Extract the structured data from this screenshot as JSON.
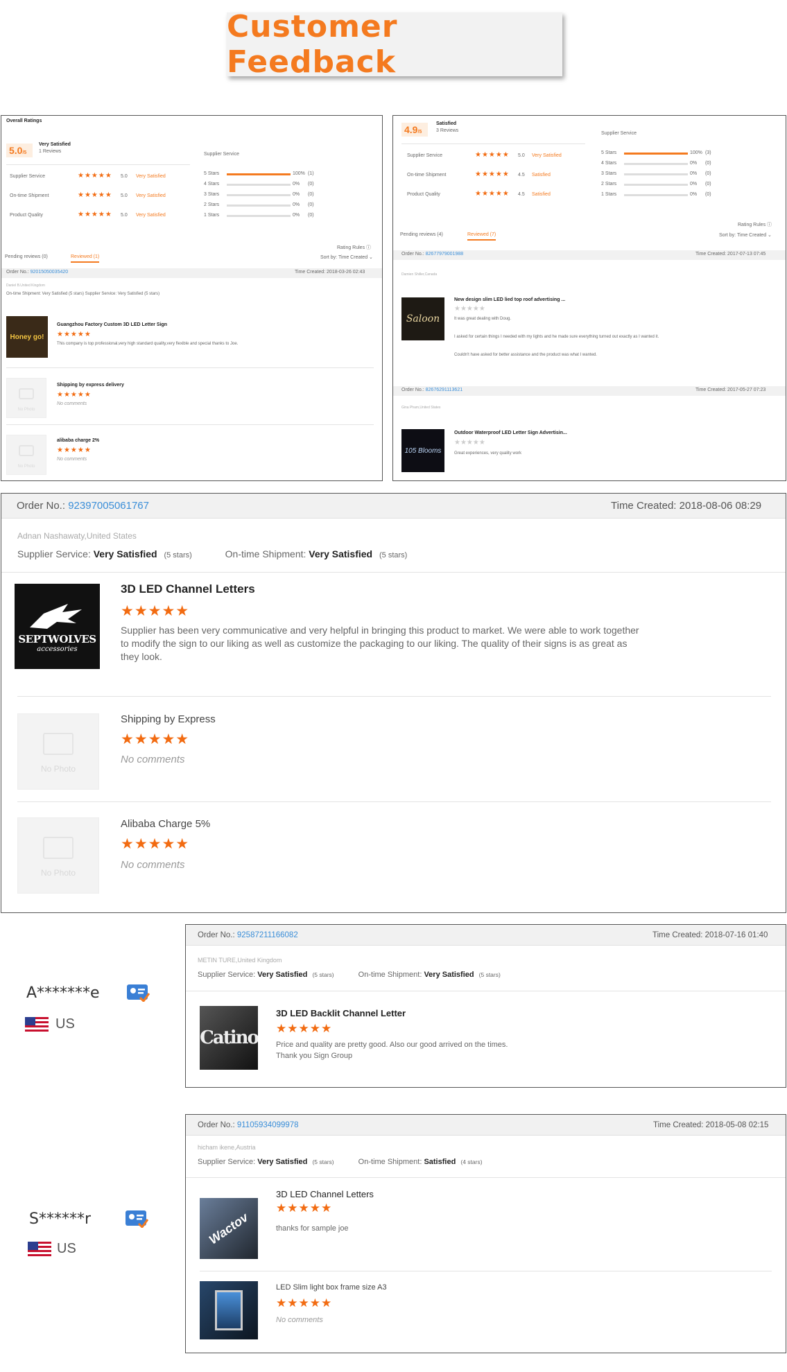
{
  "page": {
    "title": "Customer Feedback"
  },
  "shot1": {
    "overall": "Overall Ratings",
    "score": "5.0",
    "score_suffix": "/5",
    "sat": "Very Satisfied",
    "reviews": "1 Reviews",
    "metrics": [
      {
        "label": "Supplier Service",
        "stars": "★★★★★",
        "val": "5.0",
        "text": "Very Satisfied"
      },
      {
        "label": "On-time Shipment",
        "stars": "★★★★★",
        "val": "5.0",
        "text": "Very Satisfied"
      },
      {
        "label": "Product Quality",
        "stars": "★★★★★",
        "val": "5.0",
        "text": "Very Satisfied"
      }
    ],
    "service_title": "Supplier Service",
    "dist": [
      {
        "label": "5 Stars",
        "pct": "100%",
        "count": "(1)",
        "fill": 1.0
      },
      {
        "label": "4 Stars",
        "pct": "0%",
        "count": "(0)",
        "fill": 0
      },
      {
        "label": "3 Stars",
        "pct": "0%",
        "count": "(0)",
        "fill": 0
      },
      {
        "label": "2 Stars",
        "pct": "0%",
        "count": "(0)",
        "fill": 0
      },
      {
        "label": "1 Stars",
        "pct": "0%",
        "count": "(0)",
        "fill": 0
      }
    ],
    "rating_rules": "Rating Rules ⓘ",
    "tab_pending": "Pending reviews (0)",
    "tab_reviewed": "Reviewed (1)",
    "sort": "Sort by: Time Created ⌄",
    "order_label": "Order No.:",
    "order_no": "92015050035420",
    "time_created": "Time Created: 2018-03-26 02:43",
    "buyer": "Daniel B.United Kingdom",
    "ratings_line": "On-time Shipment: Very Satisfied (5 stars)     Supplier Service: Very Satisfied (5 stars)",
    "item1_title": "Guangzhou Factory Custom 3D LED Letter Sign",
    "item1_stars": "★★★★★",
    "item1_comment": "This company is top professional,very high standard quality,very flexible and special thanks to Joe.",
    "item1_thumb": "Honey go!",
    "item2_title": "Shipping by express delivery",
    "item2_stars": "★★★★★",
    "item2_comment": "No comments",
    "item3_title": "alibaba charge 2%",
    "item3_stars": "★★★★★",
    "item3_comment": "No comments",
    "no_photo": "No Photo"
  },
  "shot2": {
    "score": "4.9",
    "score_suffix": "/5",
    "sat": "Satisfied",
    "reviews": "3 Reviews",
    "metrics": [
      {
        "label": "Supplier Service",
        "stars": "★★★★★",
        "val": "5.0",
        "text": "Very Satisfied"
      },
      {
        "label": "On-time Shipment",
        "stars": "★★★★★",
        "val": "4.5",
        "text": "Satisfied"
      },
      {
        "label": "Product Quality",
        "stars": "★★★★★",
        "val": "4.5",
        "text": "Satisfied"
      }
    ],
    "service_title": "Supplier Service",
    "dist": [
      {
        "label": "5 Stars",
        "pct": "100%",
        "count": "(3)",
        "fill": 1.0
      },
      {
        "label": "4 Stars",
        "pct": "0%",
        "count": "(0)",
        "fill": 0
      },
      {
        "label": "3 Stars",
        "pct": "0%",
        "count": "(0)",
        "fill": 0
      },
      {
        "label": "2 Stars",
        "pct": "0%",
        "count": "(0)",
        "fill": 0
      },
      {
        "label": "1 Stars",
        "pct": "0%",
        "count": "(0)",
        "fill": 0
      }
    ],
    "rating_rules": "Rating Rules ⓘ",
    "tab_pending": "Pending reviews (4)",
    "tab_reviewed": "Reviewed (7)",
    "sort": "Sort by: Time Created ⌄",
    "order1_label": "Order No.:",
    "order1_no": "82677979001988",
    "order1_time": "Time Created: 2017-07-13 07:45",
    "order1_buyer": "Damien Shiller,Canada",
    "order1_item": "New design slim LED lied top roof advertising ...",
    "order1_stars": "★★★★★",
    "order1_c1": "It was great dealing with Doug.",
    "order1_c2": "I asked for certain things I needed with my lights and he made sure everything turned out exactly as I wanted it.",
    "order1_c3": "Couldn't have asked for better assistance and the product was what I wanted.",
    "order1_thumb": "Saloon",
    "order2_label": "Order No.:",
    "order2_no": "82676291113621",
    "order2_time": "Time Created: 2017-05-27 07:23",
    "order2_buyer": "Gina Pham,United States",
    "order2_item": "Outdoor Waterproof LED Letter Sign Advertisin...",
    "order2_stars": "★★★★★",
    "order2_comment": "Great experiences,  very quality work",
    "order2_thumb": "105 Blooms"
  },
  "big": {
    "order_label": "Order No.:",
    "order_no": "92397005061767",
    "time_created": "Time Created: 2018-08-06 08:29",
    "buyer": "Adnan Nashawaty,United States",
    "supplier_label": "Supplier Service:",
    "supplier_value": "Very Satisfied",
    "supplier_stars": "(5 stars)",
    "shipment_label": "On-time Shipment:",
    "shipment_value": "Very Satisfied",
    "shipment_stars": "(5 stars)",
    "item1_title": "3D LED Channel Letters",
    "item1_stars": "★★★★★",
    "item1_comment": "Supplier has been very communicative and very helpful in bringing this product to market. We were able to work together to modify the sign to our liking as well as customize the packaging to our liking. The quality of their signs is as great as they look.",
    "item1_thumb_brand": "SEPTWOLVES",
    "item1_thumb_sub": "accessories",
    "item2_title": "Shipping by Express",
    "item2_stars": "★★★★★",
    "item2_comment": "No comments",
    "item3_title": "Alibaba Charge 5%",
    "item3_stars": "★★★★★",
    "item3_comment": "No comments",
    "no_photo": "No Photo"
  },
  "rev1": {
    "user": "A*******e",
    "country": "US",
    "order_label": "Order No.:",
    "order_no": "92587211166082",
    "time_created": "Time Created: 2018-07-16 01:40",
    "buyer": "METIN TURE,United Kingdom",
    "supplier_label": "Supplier Service:",
    "supplier_value": "Very Satisfied",
    "supplier_stars": "(5 stars)",
    "shipment_label": "On-time Shipment:",
    "shipment_value": "Very Satisfied",
    "shipment_stars": "(5 stars)",
    "item_title": "3D LED Backlit Channel Letter",
    "item_stars": "★★★★★",
    "comment1": "Price and quality are pretty good. Also our good arrived on the times.",
    "comment2": "Thank you Sign Group",
    "thumb": "Catino"
  },
  "rev2": {
    "user": "S******r",
    "country": "US",
    "order_label": "Order No.:",
    "order_no": "91105934099978",
    "time_created": "Time Created: 2018-05-08 02:15",
    "buyer": "hicham ikene,Austria",
    "supplier_label": "Supplier Service:",
    "supplier_value": "Very Satisfied",
    "supplier_stars": "(5 stars)",
    "shipment_label": "On-time Shipment:",
    "shipment_value": "Satisfied",
    "shipment_stars": "(4 stars)",
    "item1_title": "3D LED Channel Letters",
    "item1_stars": "★★★★★",
    "item1_comment": "thanks for sample joe",
    "item1_thumb": "Wactov",
    "item2_title": "LED Slim light box frame size A3",
    "item2_stars": "★★★★★",
    "item2_comment": "No comments"
  },
  "colors": {
    "accent": "#f47a1f",
    "link": "#3a8ed8",
    "star": "#f26b11"
  }
}
